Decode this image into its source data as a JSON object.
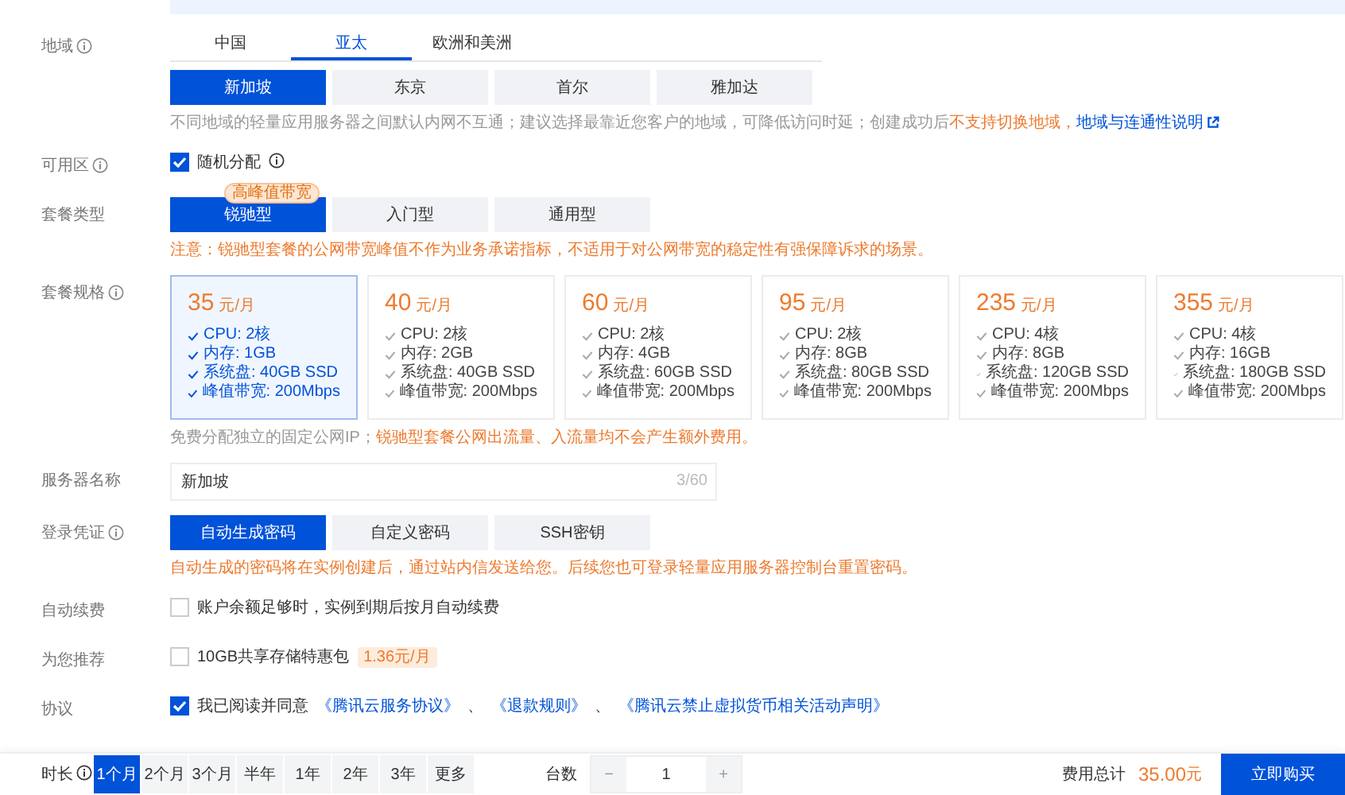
{
  "region": {
    "label": {
      "text": "地域",
      "info": true
    },
    "tabs": [
      {
        "label": "中国",
        "selected": false
      },
      {
        "label": "亚太",
        "selected": true
      },
      {
        "label": "欧洲和美洲",
        "selected": false
      }
    ],
    "cities": [
      {
        "label": "新加坡",
        "selected": true
      },
      {
        "label": "东京",
        "selected": false
      },
      {
        "label": "首尔",
        "selected": false
      },
      {
        "label": "雅加达",
        "selected": false
      }
    ],
    "note": [
      {
        "kind": "plain",
        "text": "不同地域的轻量应用服务器之间默认内网不互通；建议选择最靠近您客户的地域，可降低访问时延；创建成功后"
      },
      {
        "kind": "warn",
        "text": "不支持切换地域，"
      },
      {
        "kind": "link",
        "text": "地域与连通性说明",
        "external": true
      }
    ]
  },
  "zone": {
    "label": {
      "text": "可用区",
      "info": true
    },
    "checked": true,
    "text": "随机分配",
    "info": true
  },
  "plan_type": {
    "label": {
      "text": "套餐类型"
    },
    "options": [
      {
        "label": "锐驰型",
        "selected": true,
        "badge": "高峰值带宽"
      },
      {
        "label": "入门型",
        "selected": false
      },
      {
        "label": "通用型",
        "selected": false
      }
    ],
    "note": "注意：锐驰型套餐的公网带宽峰值不作为业务承诺指标，不适用于对公网带宽的稳定性有强保障诉求的场景。"
  },
  "specs": {
    "label": {
      "text": "套餐规格",
      "info": true
    },
    "plans": [
      {
        "price": "35",
        "unit": "元/月",
        "selected": true,
        "features": [
          "CPU: 2核",
          "内存: 1GB",
          "系统盘: 40GB SSD",
          "峰值带宽: 200Mbps"
        ]
      },
      {
        "price": "40",
        "unit": "元/月",
        "selected": false,
        "features": [
          "CPU: 2核",
          "内存: 2GB",
          "系统盘: 40GB SSD",
          "峰值带宽: 200Mbps"
        ]
      },
      {
        "price": "60",
        "unit": "元/月",
        "selected": false,
        "features": [
          "CPU: 2核",
          "内存: 4GB",
          "系统盘: 60GB SSD",
          "峰值带宽: 200Mbps"
        ]
      },
      {
        "price": "95",
        "unit": "元/月",
        "selected": false,
        "features": [
          "CPU: 2核",
          "内存: 8GB",
          "系统盘: 80GB SSD",
          "峰值带宽: 200Mbps"
        ]
      },
      {
        "price": "235",
        "unit": "元/月",
        "selected": false,
        "features": [
          "CPU: 4核",
          "内存: 8GB",
          "系统盘: 120GB SSD",
          "峰值带宽: 200Mbps"
        ]
      },
      {
        "price": "355",
        "unit": "元/月",
        "selected": false,
        "features": [
          "CPU: 4核",
          "内存: 16GB",
          "系统盘: 180GB SSD",
          "峰值带宽: 200Mbps"
        ]
      }
    ],
    "note": [
      {
        "kind": "plain",
        "text": "免费分配独立的固定公网IP；"
      },
      {
        "kind": "warn",
        "text": "锐驰型套餐公网出流量、入流量均不会产生额外费用。"
      }
    ]
  },
  "server_name": {
    "label": {
      "text": "服务器名称"
    },
    "value": "新加坡",
    "counter": "3/60"
  },
  "credentials": {
    "label": {
      "text": "登录凭证",
      "info": true
    },
    "options": [
      {
        "label": "自动生成密码",
        "selected": true
      },
      {
        "label": "自定义密码",
        "selected": false
      },
      {
        "label": "SSH密钥",
        "selected": false
      }
    ],
    "note": "自动生成的密码将在实例创建后，通过站内信发送给您。后续您也可登录轻量应用服务器控制台重置密码。"
  },
  "auto_renew": {
    "label": {
      "text": "自动续费"
    },
    "checked": false,
    "text": "账户余额足够时，实例到期后按月自动续费"
  },
  "recommend": {
    "label": {
      "text": "为您推荐"
    },
    "checked": false,
    "text": "10GB共享存储特惠包",
    "badge": "1.36元/月"
  },
  "agreement": {
    "label": {
      "text": "协议"
    },
    "checked": true,
    "segments": [
      {
        "kind": "plain",
        "text": "我已阅读并同意"
      },
      {
        "kind": "link",
        "text": "《腾讯云服务协议》"
      },
      {
        "kind": "plain",
        "text": "、"
      },
      {
        "kind": "link",
        "text": "《退款规则》"
      },
      {
        "kind": "plain",
        "text": "、"
      },
      {
        "kind": "link",
        "text": "《腾讯云禁止虚拟货币相关活动声明》"
      }
    ]
  },
  "footer": {
    "duration_label": {
      "text": "时长",
      "info": true
    },
    "durations": [
      {
        "label": "1个月",
        "selected": true
      },
      {
        "label": "2个月",
        "selected": false
      },
      {
        "label": "3个月",
        "selected": false
      },
      {
        "label": "半年",
        "selected": false
      },
      {
        "label": "1年",
        "selected": false
      },
      {
        "label": "2年",
        "selected": false
      },
      {
        "label": "3年",
        "selected": false
      },
      {
        "label": "更多",
        "selected": false
      }
    ],
    "quantity_label": "台数",
    "minus": "−",
    "quantity": "1",
    "plus": "+",
    "total_label": "费用总计",
    "total_amount": "35.00",
    "total_unit": "元",
    "buy": "立即购买"
  }
}
